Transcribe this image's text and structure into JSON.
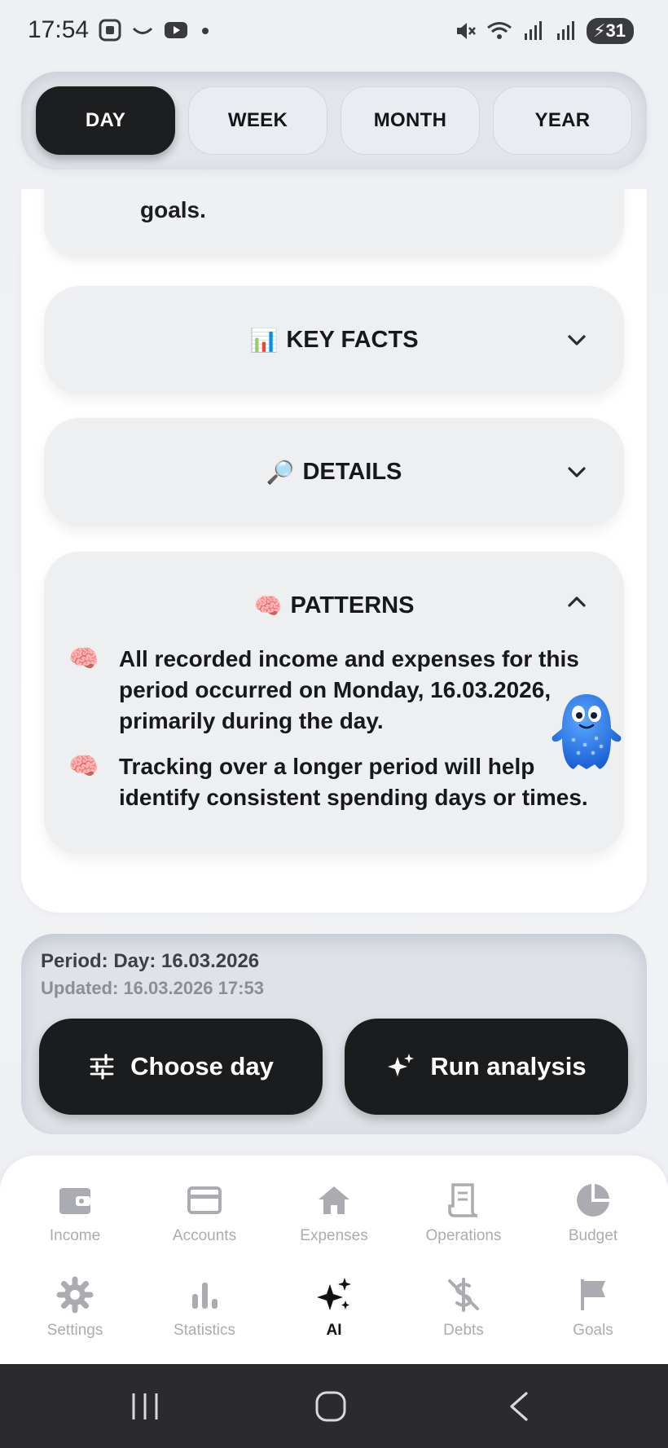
{
  "status_bar": {
    "time": "17:54",
    "battery": "31"
  },
  "period_tabs": [
    {
      "label": "DAY",
      "active": true
    },
    {
      "label": "WEEK",
      "active": false
    },
    {
      "label": "MONTH",
      "active": false
    },
    {
      "label": "YEAR",
      "active": false
    }
  ],
  "summary": {
    "tail_text": "goals."
  },
  "sections": {
    "key_facts": {
      "emoji": "📊",
      "title": "KEY FACTS",
      "expanded": false
    },
    "details": {
      "emoji": "🔎",
      "title": "DETAILS",
      "expanded": false
    },
    "patterns": {
      "emoji": "🧠",
      "title": "PATTERNS",
      "expanded": true,
      "items": [
        {
          "bullet": "🧠",
          "text": "All recorded income and expenses for this period occurred on Monday, 16.03.2026, primarily during the day."
        },
        {
          "bullet": "🧠",
          "text": "Tracking over a longer period will help identify consistent spending days or times."
        }
      ]
    }
  },
  "footer": {
    "period": "Period: Day: 16.03.2026",
    "updated": "Updated: 16.03.2026 17:53",
    "choose_day_label": "Choose day",
    "run_analysis_label": "Run analysis"
  },
  "bottom_nav": [
    {
      "label": "Income",
      "icon": "wallet-icon",
      "active": false
    },
    {
      "label": "Accounts",
      "icon": "credit-card-icon",
      "active": false
    },
    {
      "label": "Expenses",
      "icon": "home-icon",
      "active": false
    },
    {
      "label": "Operations",
      "icon": "receipt-icon",
      "active": false
    },
    {
      "label": "Budget",
      "icon": "pie-chart-icon",
      "active": false
    },
    {
      "label": "Settings",
      "icon": "gear-icon",
      "active": false
    },
    {
      "label": "Statistics",
      "icon": "bar-chart-icon",
      "active": false
    },
    {
      "label": "AI",
      "icon": "sparkles-icon",
      "active": true
    },
    {
      "label": "Debts",
      "icon": "dollar-off-icon",
      "active": false
    },
    {
      "label": "Goals",
      "icon": "flag-icon",
      "active": false
    }
  ],
  "colors": {
    "accent_dark": "#1b1c1e",
    "inactive": "#aaacb1",
    "background": "#eef0f4"
  }
}
